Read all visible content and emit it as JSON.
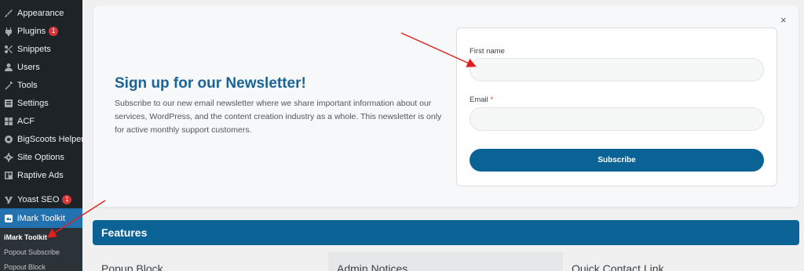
{
  "sidebar": {
    "items": [
      {
        "label": "Appearance",
        "icon": "paintbrush-icon"
      },
      {
        "label": "Plugins",
        "icon": "plug-icon",
        "badge": "1"
      },
      {
        "label": "Snippets",
        "icon": "scissors-icon"
      },
      {
        "label": "Users",
        "icon": "user-icon"
      },
      {
        "label": "Tools",
        "icon": "wrench-icon"
      },
      {
        "label": "Settings",
        "icon": "settings-icon"
      },
      {
        "label": "ACF",
        "icon": "grid-icon"
      },
      {
        "label": "BigScoots Helper",
        "icon": "helper-icon"
      },
      {
        "label": "Site Options",
        "icon": "gear-icon"
      },
      {
        "label": "Raptive Ads",
        "icon": "ads-icon"
      },
      {
        "label": "Yoast SEO",
        "icon": "yoast-icon",
        "badge": "1"
      },
      {
        "label": "iMark Toolkit",
        "icon": "imark-icon"
      }
    ],
    "submenu": [
      "iMark Toolkit",
      "Popout Subscribe",
      "Popout Block"
    ]
  },
  "modal": {
    "close": "×",
    "title": "Sign up for our Newsletter!",
    "description": "Subscribe to our new email newsletter where we share important information about our services, WordPress, and the content creation industry as a whole. This newsletter is only for active monthly support customers.",
    "first_name_label": "First name",
    "email_label": "Email",
    "required_mark": "*",
    "first_name_value": "",
    "email_value": "",
    "subscribe_label": "Subscribe"
  },
  "features": {
    "title": "Features",
    "columns": [
      "Popup Block",
      "Admin Notices",
      "Quick Contact Link"
    ]
  },
  "colors": {
    "sidebar_bg": "#1d2327",
    "accent_blue": "#0b6295",
    "active_menu": "#2271b1",
    "title_blue": "#1a6496",
    "annotation_arrow": "#e02020"
  }
}
